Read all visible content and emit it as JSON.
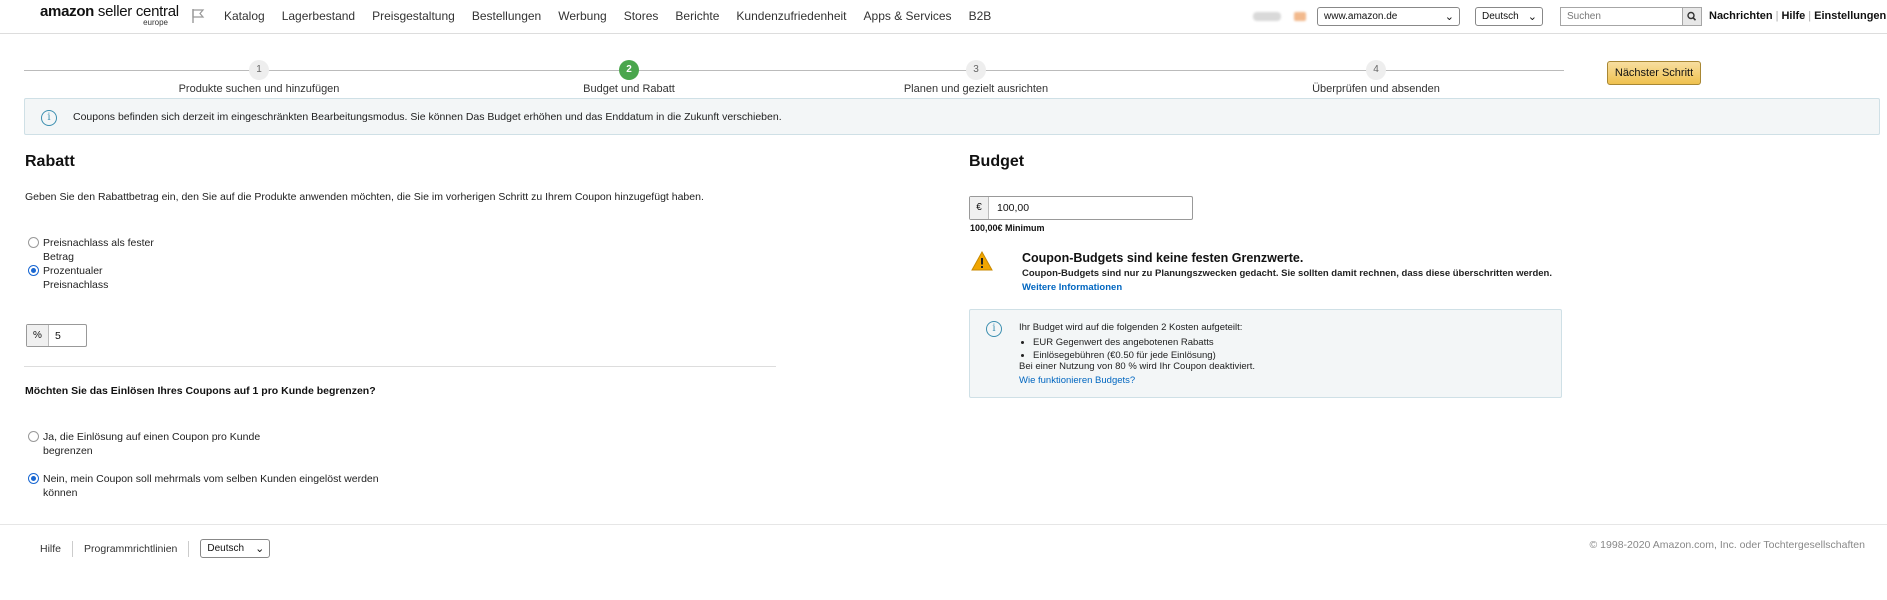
{
  "header": {
    "logo_main": "amazon",
    "logo_rest": " seller central",
    "logo_sub": "europe",
    "menu": [
      "Katalog",
      "Lagerbestand",
      "Preisgestaltung",
      "Bestellungen",
      "Werbung",
      "Stores",
      "Berichte",
      "Kundenzufriedenheit",
      "Apps & Services",
      "B2B"
    ],
    "marketplace": "www.amazon.de",
    "language": "Deutsch",
    "search_placeholder": "Suchen",
    "links": [
      "Nachrichten",
      "Hilfe",
      "Einstellungen"
    ]
  },
  "stepper": {
    "steps": [
      {
        "number": "1",
        "label": "Produkte suchen und hinzufügen"
      },
      {
        "number": "2",
        "label": "Budget und Rabatt"
      },
      {
        "number": "3",
        "label": "Planen und gezielt ausrichten"
      },
      {
        "number": "4",
        "label": "Überprüfen und absenden"
      }
    ],
    "active_step": 2,
    "next_button": "Nächster Schritt"
  },
  "banner": {
    "text": "Coupons befinden sich derzeit im eingeschränkten Bearbeitungsmodus. Sie können Das Budget erhöhen und das Enddatum in die Zukunft verschieben."
  },
  "rabatt": {
    "title": "Rabatt",
    "description": "Geben Sie den Rabattbetrag ein, den Sie auf die Produkte anwenden möchten, die Sie im vorherigen Schritt zu Ihrem Coupon hinzugefügt haben.",
    "options": [
      {
        "line1": "Preisnachlass als fester",
        "line2": "Betrag",
        "selected": false
      },
      {
        "line1": "Prozentualer",
        "line2": "Preisnachlass",
        "selected": true
      }
    ],
    "unit": "%",
    "value": "5",
    "question": "Möchten Sie das Einlösen Ihres Coupons auf 1 pro Kunde begrenzen?",
    "limit_options": [
      {
        "line1": "Ja, die Einlösung auf einen Coupon pro Kunde",
        "line2": "begrenzen",
        "selected": false
      },
      {
        "line1": "Nein, mein Coupon soll mehrmals vom selben Kunden eingelöst werden",
        "line2": "können",
        "selected": true
      }
    ]
  },
  "budget": {
    "title": "Budget",
    "currency": "€",
    "value": "100,00",
    "minimum": "100,00€ Minimum",
    "warning_title": "Coupon-Budgets sind keine festen Grenzwerte.",
    "warning_text": "Coupon-Budgets sind nur zu Planungszwecken gedacht. Sie sollten damit rechnen, dass diese überschritten werden.",
    "warning_link": "Weitere Informationen",
    "info_intro": "Ihr Budget wird auf die folgenden 2 Kosten aufgeteilt:",
    "info_items": [
      "EUR Gegenwert des angebotenen Rabatts",
      "Einlösegebühren (€0.50 für jede Einlösung)"
    ],
    "info_note": "Bei einer Nutzung von 80 % wird Ihr Coupon deaktiviert.",
    "info_link": "Wie funktionieren Budgets?"
  },
  "footer": {
    "help": "Hilfe",
    "policies": "Programmrichtlinien",
    "language": "Deutsch",
    "copyright": "© 1998-2020 Amazon.com, Inc. oder Tochtergesellschaften"
  },
  "colors": {
    "active_step": "#4aa64d",
    "link": "#0066c0",
    "button": "#efc14e",
    "warning": "#f0a500"
  }
}
